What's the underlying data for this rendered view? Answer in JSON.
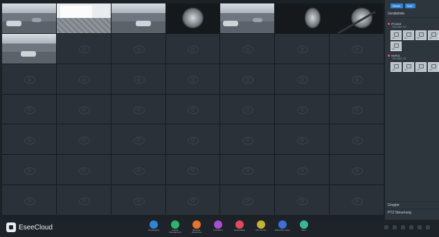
{
  "sidebar": {
    "buttons": [
      "Neust.",
      "Nutz."
    ],
    "device_list_title": "Geräteliste",
    "devices": [
      {
        "name": "IPCAM1",
        "sub": "192.168.1.10"
      },
      {
        "name": "NVR01",
        "sub": "192.168.1.20"
      }
    ],
    "thumb_label": "CH",
    "footer_group": "Gruppe",
    "footer_ptz": "PTZ Steuerung"
  },
  "taskbar": {
    "logo_text": "EseeCloud",
    "tools": [
      {
        "label": "Wiedergabe",
        "color": "#2f86d6"
      },
      {
        "label": "Geräte Management",
        "color": "#2db56e"
      },
      {
        "label": "Browser Ereignisse",
        "color": "#e8732c"
      },
      {
        "label": "Aufnahme",
        "color": "#a54fd1"
      },
      {
        "label": "Ereignisliste",
        "color": "#e14a5e"
      },
      {
        "label": "Alle trennen",
        "color": "#c7b133"
      },
      {
        "label": "Bildschirm teilen",
        "color": "#3d6fd6"
      },
      {
        "label": "Beim",
        "color": "#36b89c"
      }
    ]
  }
}
